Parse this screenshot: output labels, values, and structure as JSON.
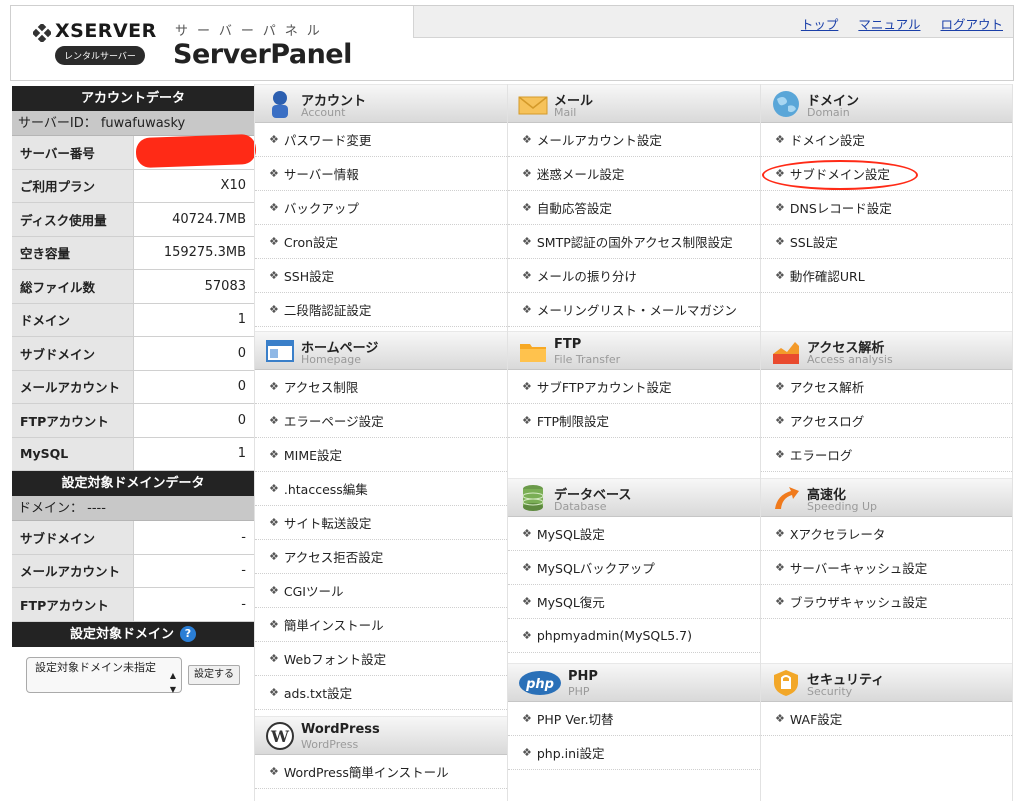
{
  "header": {
    "brand": "XSERVER",
    "badge": "レンタルサーバー",
    "panel_sub": "サーバーパネル",
    "panel_name": "ServerPanel",
    "links": [
      "トップ",
      "マニュアル",
      "ログアウト"
    ]
  },
  "sidebar": {
    "account_title": "アカウントデータ",
    "server_id": "サーバーID： fuwafuwasky",
    "rows": [
      {
        "k": "サーバー番号",
        "v": ""
      },
      {
        "k": "ご利用プラン",
        "v": "X10"
      },
      {
        "k": "ディスク使用量",
        "v": "40724.7MB"
      },
      {
        "k": "空き容量",
        "v": "159275.3MB"
      },
      {
        "k": "総ファイル数",
        "v": "57083"
      },
      {
        "k": "ドメイン",
        "v": "1"
      },
      {
        "k": "サブドメイン",
        "v": "0"
      },
      {
        "k": "メールアカウント",
        "v": "0"
      },
      {
        "k": "FTPアカウント",
        "v": "0"
      },
      {
        "k": "MySQL",
        "v": "1"
      }
    ],
    "domain_data_title": "設定対象ドメインデータ",
    "domain_line": "ドメイン： ----",
    "domain_rows": [
      {
        "k": "サブドメイン",
        "v": "-"
      },
      {
        "k": "メールアカウント",
        "v": "-"
      },
      {
        "k": "FTPアカウント",
        "v": "-"
      }
    ],
    "target_title": "設定対象ドメイン",
    "help": "?",
    "select_value": "設定対象ドメイン未指定",
    "set_button": "設定する"
  },
  "arrow": "❖",
  "sections": {
    "account": {
      "t1": "アカウント",
      "t2": "Account",
      "items": [
        "パスワード変更",
        "サーバー情報",
        "バックアップ",
        "Cron設定",
        "SSH設定",
        "二段階認証設定"
      ]
    },
    "homepage": {
      "t1": "ホームページ",
      "t2": "Homepage",
      "items": [
        "アクセス制限",
        "エラーページ設定",
        "MIME設定",
        ".htaccess編集",
        "サイト転送設定",
        "アクセス拒否設定",
        "CGIツール",
        "簡単インストール",
        "Webフォント設定",
        "ads.txt設定"
      ]
    },
    "wordpress": {
      "t1": "WordPress",
      "t2": "WordPress",
      "items": [
        "WordPress簡単インストール"
      ]
    },
    "mail": {
      "t1": "メール",
      "t2": "Mail",
      "items": [
        "メールアカウント設定",
        "迷惑メール設定",
        "自動応答設定",
        "SMTP認証の国外アクセス制限設定",
        "メールの振り分け",
        "メーリングリスト・メールマガジン"
      ]
    },
    "ftp": {
      "t1": "FTP",
      "t2": "File Transfer",
      "items": [
        "サブFTPアカウント設定",
        "FTP制限設定"
      ]
    },
    "database": {
      "t1": "データベース",
      "t2": "Database",
      "items": [
        "MySQL設定",
        "MySQLバックアップ",
        "MySQL復元",
        "phpmyadmin(MySQL5.7)"
      ]
    },
    "php": {
      "t1": "PHP",
      "t2": "PHP",
      "icon_text": "php",
      "items": [
        "PHP Ver.切替",
        "php.ini設定"
      ]
    },
    "domain": {
      "t1": "ドメイン",
      "t2": "Domain",
      "items": [
        "ドメイン設定",
        "サブドメイン設定",
        "DNSレコード設定",
        "SSL設定",
        "動作確認URL"
      ]
    },
    "access": {
      "t1": "アクセス解析",
      "t2": "Access analysis",
      "items": [
        "アクセス解析",
        "アクセスログ",
        "エラーログ"
      ]
    },
    "speed": {
      "t1": "高速化",
      "t2": "Speeding Up",
      "items": [
        "Xアクセラレータ",
        "サーバーキャッシュ設定",
        "ブラウザキャッシュ設定"
      ]
    },
    "security": {
      "t1": "セキュリティ",
      "t2": "Security",
      "items": [
        "WAF設定"
      ]
    }
  },
  "colors": {
    "accent_red": "#ff2a16",
    "link_blue": "#1a3fa8",
    "sidebar_dark": "#232323"
  }
}
